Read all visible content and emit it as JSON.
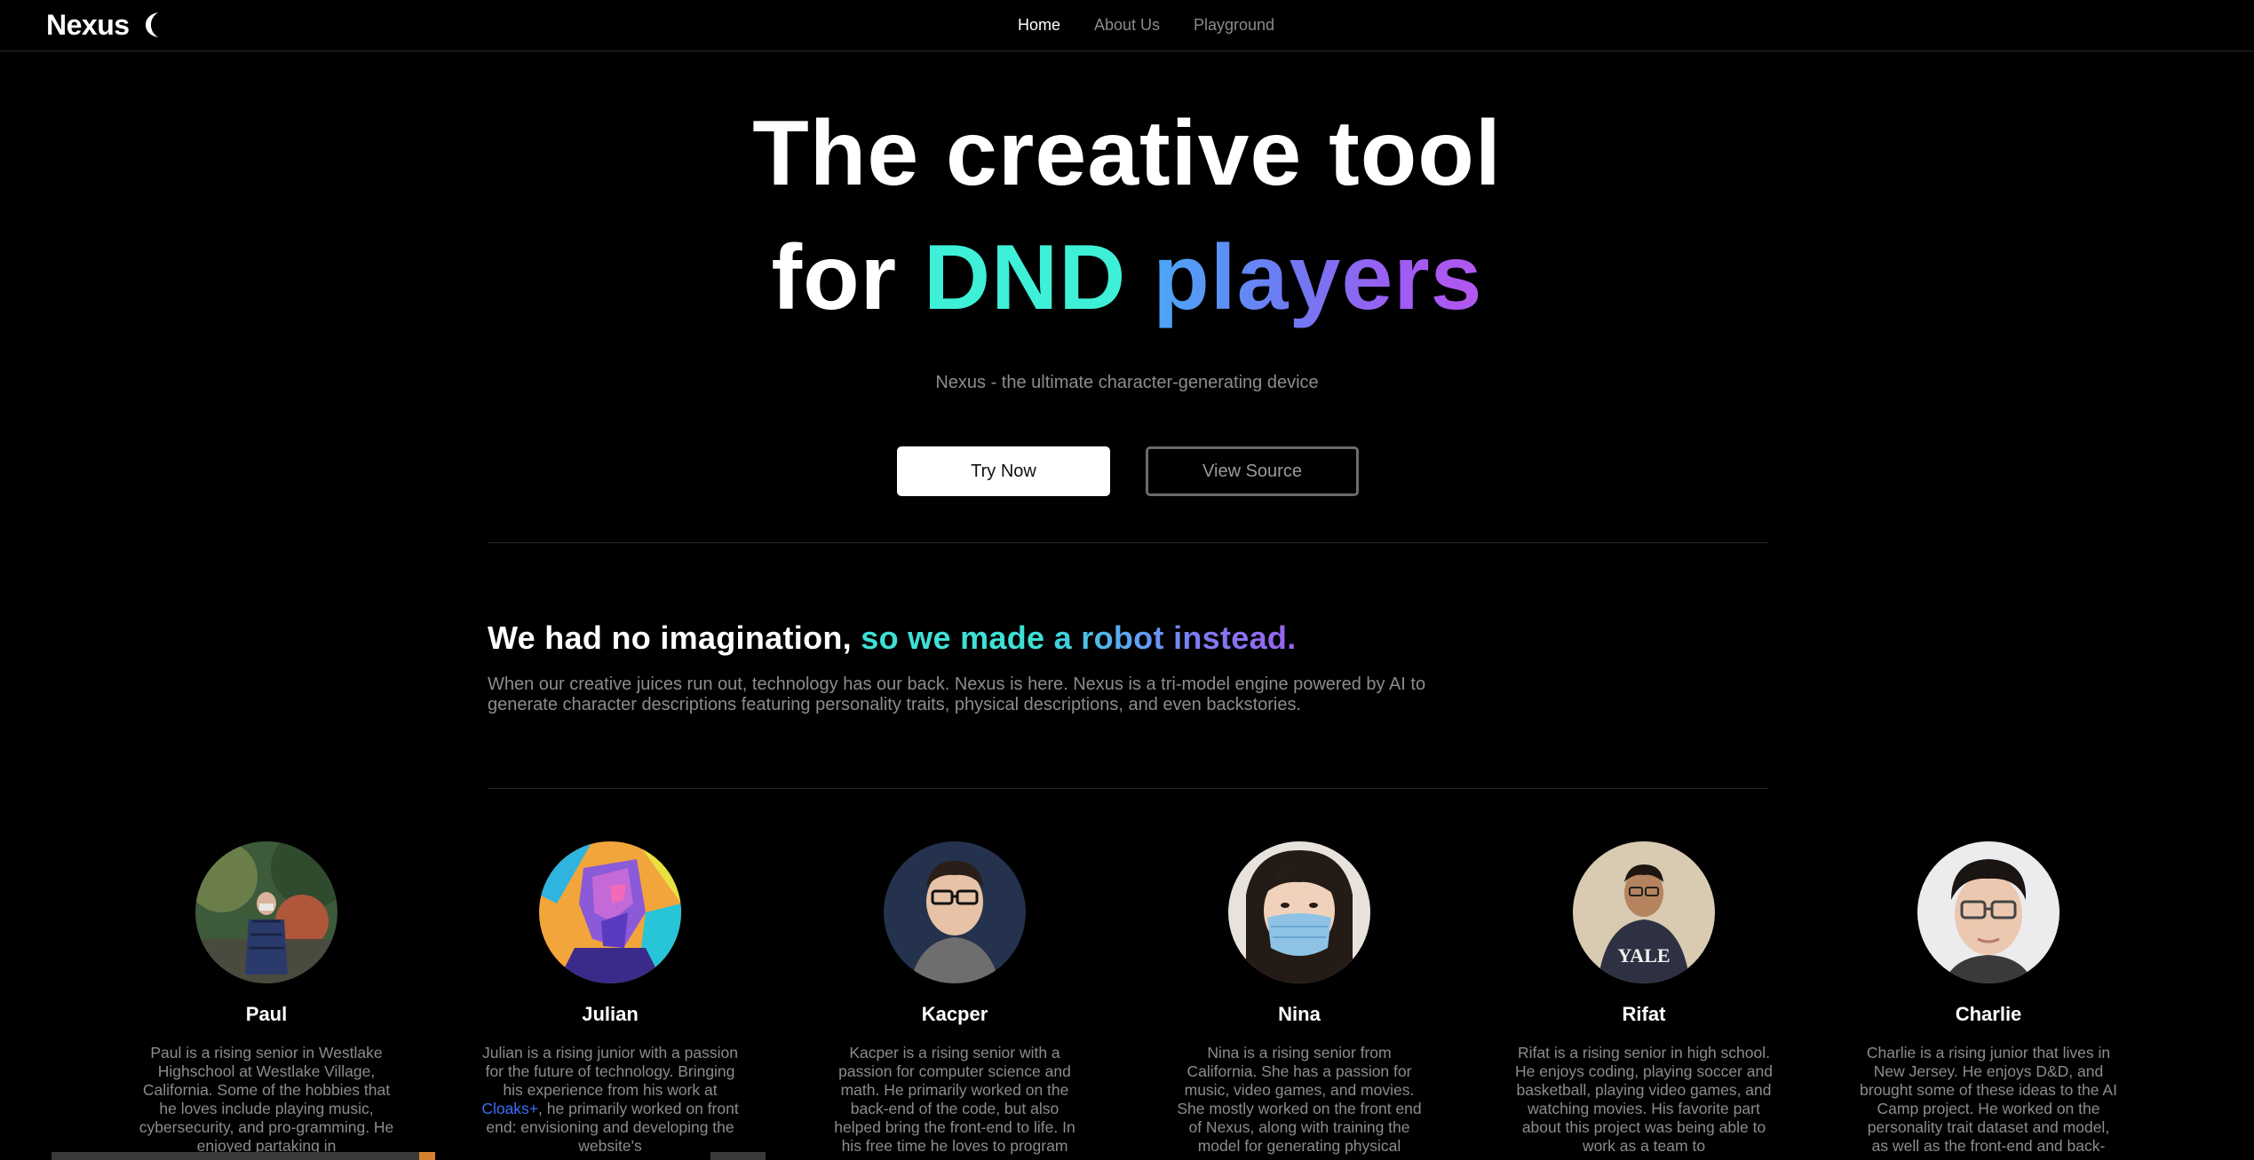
{
  "nav": {
    "brand": "Nexus",
    "links": [
      {
        "label": "Home",
        "active": true
      },
      {
        "label": "About Us",
        "active": false
      },
      {
        "label": "Playground",
        "active": false
      }
    ]
  },
  "hero": {
    "line1": "The creative tool",
    "line2_prefix": "for",
    "line2_dnd": "DND",
    "line2_players": "players",
    "subtitle": "Nexus - the ultimate character-generating device",
    "try_now": "Try Now",
    "view_source": "View Source"
  },
  "about": {
    "title_white": "We had no imagination,",
    "title_grad_1": "so we made",
    "title_grad_2": "a robot instead.",
    "body": "When our creative juices run out, technology has our back. Nexus is here. Nexus is a tri-model engine powered by AI to generate character descriptions featuring personality traits, physical descriptions, and even backstories."
  },
  "team": [
    {
      "name": "Paul",
      "bio": "Paul is a rising senior in Westlake Highschool at Westlake Village, California. Some of the hobbies that he loves include playing music, cybersecurity, and pro-gramming. He enjoyed partaking in"
    },
    {
      "name": "Julian",
      "bio_before": "Julian is a rising junior with a passion for the future of technology. Bringing his experience from his work at ",
      "bio_link": "Cloaks+",
      "bio_after": ", he primarily worked on front end: envisioning and developing the website's"
    },
    {
      "name": "Kacper",
      "bio": "Kacper is a rising senior with a passion for computer science and math. He primarily worked on the back-end of the code, but also helped bring the front-end to life. In his free time he loves to program"
    },
    {
      "name": "Nina",
      "bio": "Nina is a rising senior from California. She has a passion for music, video games, and movies. She mostly worked on the front end of Nexus, along with training the model for generating physical"
    },
    {
      "name": "Rifat",
      "bio": "Rifat is a rising senior in high school. He enjoys coding, playing soccer and basketball, playing video games, and watching movies. His favorite part about this project was being able to work as a team to"
    },
    {
      "name": "Charlie",
      "bio": "Charlie is a rising junior that lives in New Jersey. He enjoys D&D, and brought some of these ideas to the AI Camp project. He worked on the personality trait dataset and model, as well as the front-end and back-"
    }
  ],
  "icons": {
    "theme_toggle": "moon-icon"
  },
  "colors": {
    "background": "#000000",
    "accent_teal": "#3ef0d8",
    "accent_blue": "#4ba7f7",
    "accent_purple": "#b457ef",
    "muted_text": "#8c8c8c",
    "link": "#3b6ef5"
  }
}
